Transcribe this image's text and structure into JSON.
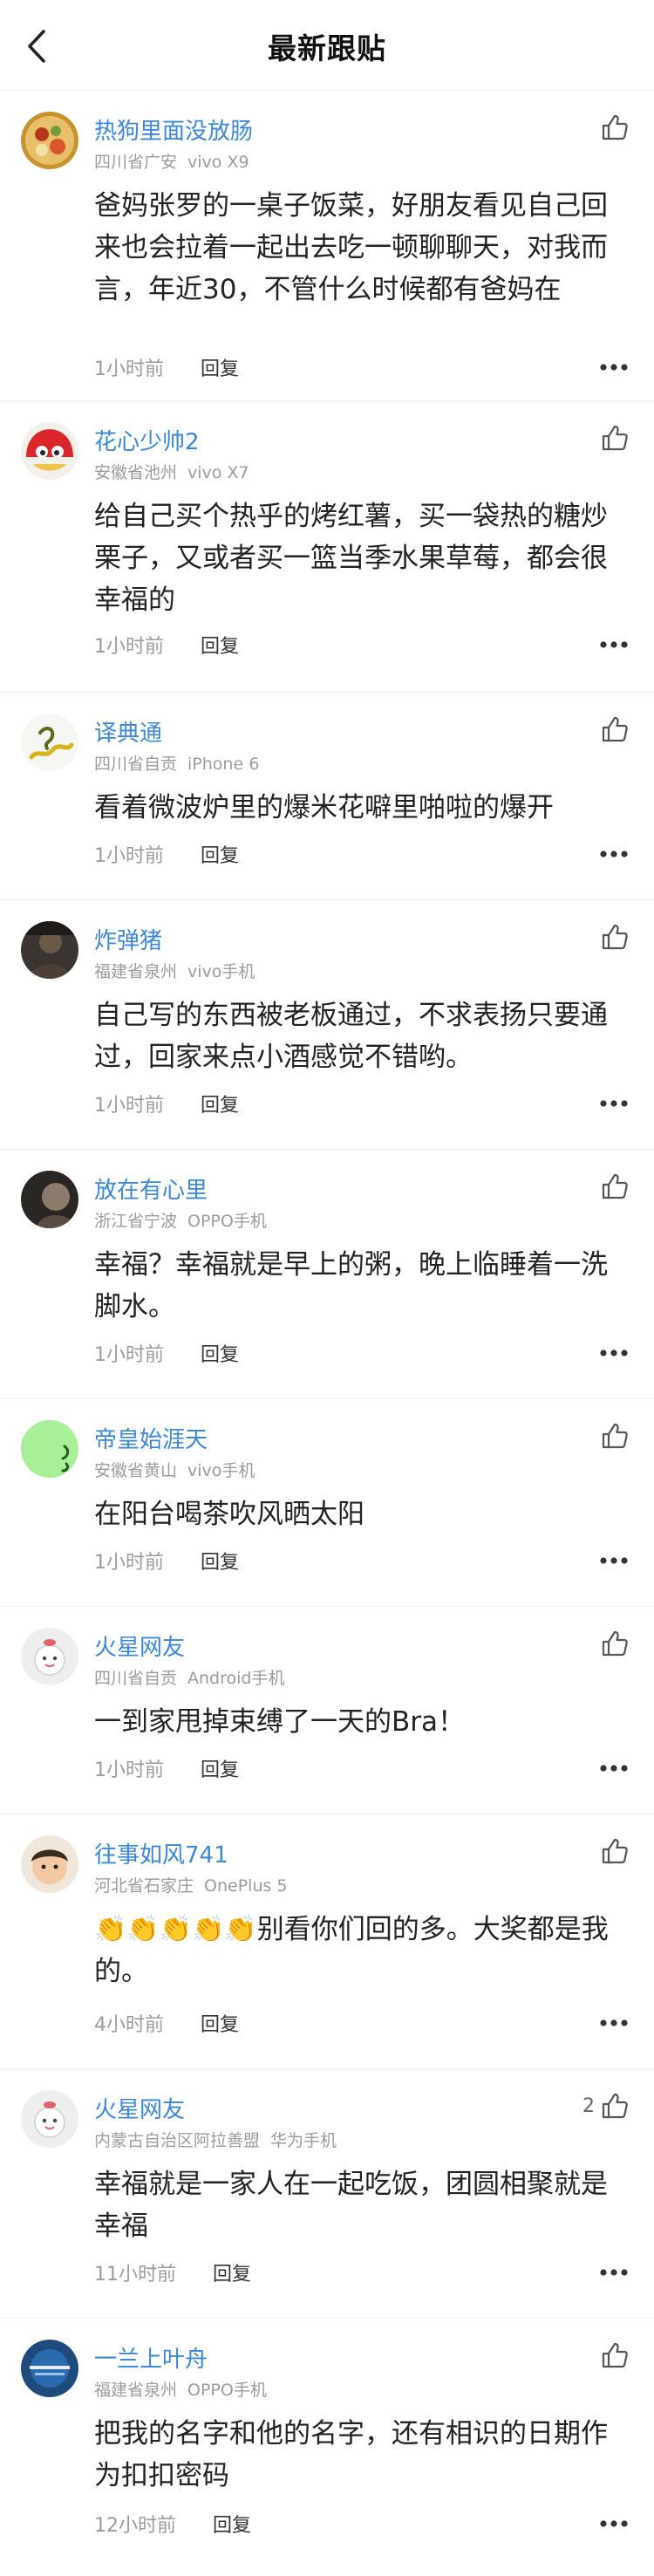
{
  "header": {
    "title": "最新跟贴"
  },
  "actions": {
    "reply_label": "回复"
  },
  "comments": [
    {
      "username": "热狗里面没放肠",
      "location": "四川省广安",
      "device": "vivo X9",
      "text": "爸妈张罗的一桌子饭菜，好朋友看见自己回来也会拉着一起出去吃一顿聊聊天，对我而言，年近30，不管什么时候都有爸妈在",
      "time": "1小时前",
      "likes": ""
    },
    {
      "username": "花心少帅2",
      "location": "安徽省池州",
      "device": "vivo X7",
      "text": "给自己买个热乎的烤红薯，买一袋热的糖炒栗子，又或者买一篮当季水果草莓，都会很幸福的",
      "time": "1小时前",
      "likes": ""
    },
    {
      "username": "译典通",
      "location": "四川省自贡",
      "device": "iPhone 6",
      "text": "看着微波炉里的爆米花噼里啪啦的爆开",
      "time": "1小时前",
      "likes": ""
    },
    {
      "username": "炸弹猪",
      "location": "福建省泉州",
      "device": "vivo手机",
      "text": "自己写的东西被老板通过，不求表扬只要通过，回家来点小酒感觉不错哟。",
      "time": "1小时前",
      "likes": ""
    },
    {
      "username": "放在有心里",
      "location": "浙江省宁波",
      "device": "OPPO手机",
      "text": "幸福？幸福就是早上的粥，晚上临睡着一洗脚水。",
      "time": "1小时前",
      "likes": ""
    },
    {
      "username": "帝皇始涯天",
      "location": "安徽省黄山",
      "device": "vivo手机",
      "text": "在阳台喝茶吹风晒太阳",
      "time": "1小时前",
      "likes": ""
    },
    {
      "username": "火星网友",
      "location": "四川省自贡",
      "device": "Android手机",
      "text": "一到家甩掉束缚了一天的Bra！",
      "time": "1小时前",
      "likes": ""
    },
    {
      "username": "往事如风741",
      "location": "河北省石家庄",
      "device": "OnePlus 5",
      "emoji": "👏👏👏👏👏",
      "text": "别看你们回的多。大奖都是我的。",
      "time": "4小时前",
      "likes": ""
    },
    {
      "username": "火星网友",
      "location": "内蒙古自治区阿拉善盟",
      "device": "华为手机",
      "text": "幸福就是一家人在一起吃饭，团圆相聚就是幸福",
      "time": "11小时前",
      "likes": "2"
    },
    {
      "username": "一兰上叶舟",
      "location": "福建省泉州",
      "device": "OPPO手机",
      "text": "把我的名字和他的名字，还有相识的日期作为扣扣密码",
      "time": "12小时前",
      "likes": ""
    }
  ],
  "icons": {
    "back": "chevron-left-icon",
    "like": "thumbs-up-icon",
    "more": "more-dots-icon"
  },
  "colors": {
    "username": "#3d87d6",
    "meta": "#9b9b9b",
    "divider": "#ededed"
  }
}
